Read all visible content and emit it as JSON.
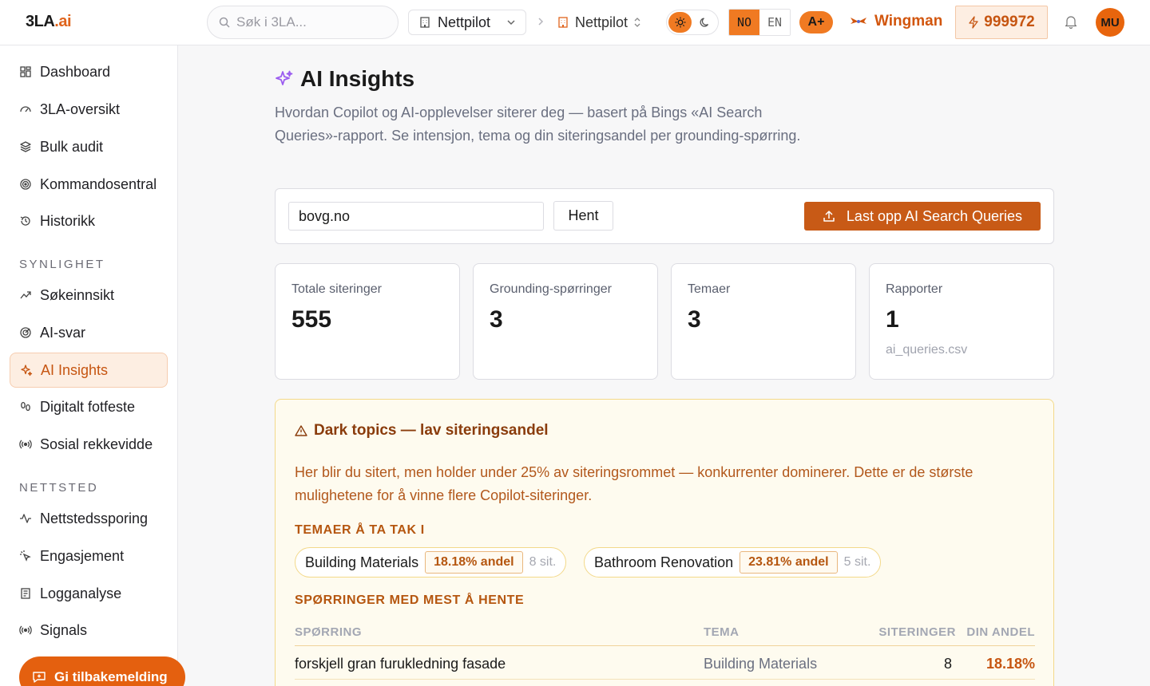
{
  "topbar": {
    "logo_main": "3LA",
    "logo_suffix": ".ai",
    "search_placeholder": "Søk i 3LA...",
    "project": "Nettpilot",
    "site": "Nettpilot",
    "lang_no": "NO",
    "lang_en": "EN",
    "grade": "A+",
    "wingman": "Wingman",
    "credits": "999972",
    "avatar": "MU"
  },
  "sidebar": {
    "items_top": [
      {
        "label": "Dashboard",
        "icon": "grid-icon"
      },
      {
        "label": "3LA-oversikt",
        "icon": "gauge-icon"
      },
      {
        "label": "Bulk audit",
        "icon": "layers-icon"
      },
      {
        "label": "Kommandosentral",
        "icon": "target-icon"
      },
      {
        "label": "Historikk",
        "icon": "history-icon"
      }
    ],
    "section_synlighet": "SYNLIGHET",
    "items_synlighet": [
      {
        "label": "Søkeinnsikt",
        "icon": "trend-icon"
      },
      {
        "label": "AI-svar",
        "icon": "radar-icon"
      },
      {
        "label": "AI Insights",
        "icon": "sparkles-icon"
      },
      {
        "label": "Digitalt fotfeste",
        "icon": "footprints-icon"
      },
      {
        "label": "Sosial rekkevidde",
        "icon": "broadcast-icon"
      }
    ],
    "section_nettsted": "NETTSTED",
    "items_nettsted": [
      {
        "label": "Nettstedssporing",
        "icon": "activity-icon"
      },
      {
        "label": "Engasjement",
        "icon": "click-icon"
      },
      {
        "label": "Logganalyse",
        "icon": "log-icon"
      },
      {
        "label": "Signals",
        "icon": "signal-icon"
      }
    ],
    "feedback": "Gi tilbakemelding"
  },
  "main": {
    "title": "AI Insights",
    "description": "Hvordan Copilot og AI-opplevelser siterer deg — basert på Bings «AI Search Queries»-rapport. Se intensjon, tema og din siteringsandel per grounding-spørring.",
    "domain_value": "bovg.no",
    "fetch_label": "Hent",
    "upload_label": "Last opp AI Search Queries",
    "stats": [
      {
        "label": "Totale siteringer",
        "value": "555",
        "sub": ""
      },
      {
        "label": "Grounding-spørringer",
        "value": "3",
        "sub": ""
      },
      {
        "label": "Temaer",
        "value": "3",
        "sub": ""
      },
      {
        "label": "Rapporter",
        "value": "1",
        "sub": "ai_queries.csv"
      }
    ],
    "dark": {
      "title": "Dark topics — lav siteringsandel",
      "description": "Her blir du sitert, men holder under 25% av siteringsrommet — konkurrenter dominerer. Dette er de største mulighetene for å vinne flere Copilot-siteringer.",
      "topics_heading": "TEMAER Å TA TAK I",
      "topics": [
        {
          "name": "Building Materials",
          "share": "18.18% andel",
          "count": "8 sit."
        },
        {
          "name": "Bathroom Renovation",
          "share": "23.81% andel",
          "count": "5 sit."
        }
      ],
      "queries_heading": "SPØRRINGER MED MEST Å HENTE",
      "columns": {
        "query": "SPØRRING",
        "topic": "TEMA",
        "citations": "SITERINGER",
        "share": "DIN ANDEL"
      },
      "rows": [
        {
          "query": "forskjell gran furukledning fasade",
          "topic": "Building Materials",
          "citations": "8",
          "share": "18.18%"
        }
      ]
    }
  },
  "colors": {
    "accent": "#f07a22",
    "accent_dark": "#c85a16",
    "warning_bg": "#fefbef",
    "warning_border": "#f3d98a"
  }
}
